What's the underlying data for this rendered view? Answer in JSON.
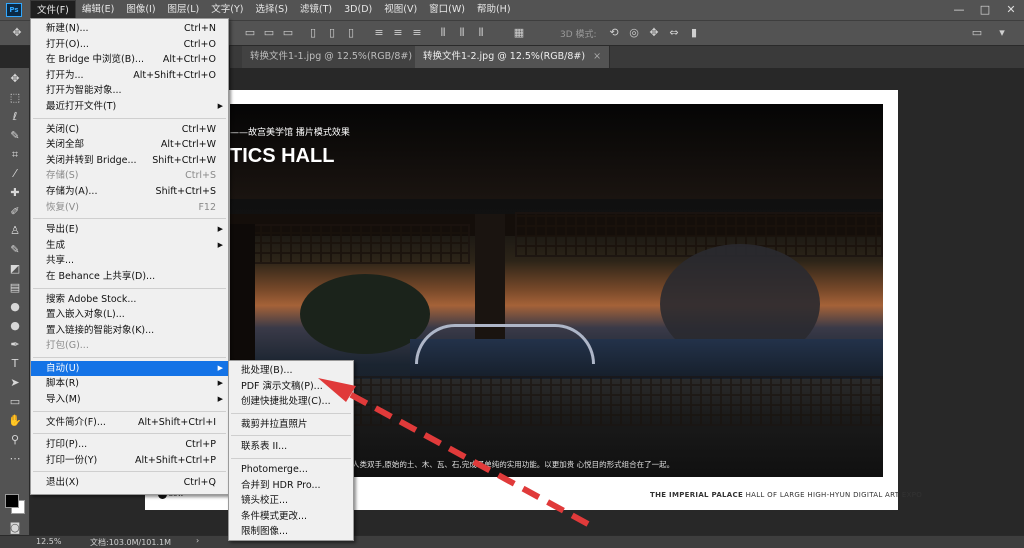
{
  "menubar": {
    "items": [
      "文件(F)",
      "编辑(E)",
      "图像(I)",
      "图层(L)",
      "文字(Y)",
      "选择(S)",
      "滤镜(T)",
      "3D(D)",
      "视图(V)",
      "窗口(W)",
      "帮助(H)"
    ],
    "window_controls": [
      "—",
      "□",
      "✕"
    ]
  },
  "options_bar": {
    "mode_3d": "3D 模式:"
  },
  "tabs": [
    {
      "label": "转换文件1-1.jpg @ 12.5%(RGB/8#)",
      "close": "×"
    },
    {
      "label": "转换文件1-2.jpg @ 12.5%(RGB/8#)",
      "close": "×"
    }
  ],
  "file_menu": {
    "groups": [
      [
        {
          "label": "新建(N)...",
          "shortcut": "Ctrl+N"
        },
        {
          "label": "打开(O)...",
          "shortcut": "Ctrl+O"
        },
        {
          "label": "在 Bridge 中浏览(B)...",
          "shortcut": "Alt+Ctrl+O"
        },
        {
          "label": "打开为...",
          "shortcut": "Alt+Shift+Ctrl+O"
        },
        {
          "label": "打开为智能对象..."
        },
        {
          "label": "最近打开文件(T)",
          "submenu": true
        }
      ],
      [
        {
          "label": "关闭(C)",
          "shortcut": "Ctrl+W"
        },
        {
          "label": "关闭全部",
          "shortcut": "Alt+Ctrl+W"
        },
        {
          "label": "关闭并转到 Bridge...",
          "shortcut": "Shift+Ctrl+W"
        },
        {
          "label": "存储(S)",
          "shortcut": "Ctrl+S",
          "disabled": true
        },
        {
          "label": "存储为(A)...",
          "shortcut": "Shift+Ctrl+S"
        },
        {
          "label": "恢复(V)",
          "shortcut": "F12",
          "disabled": true
        }
      ],
      [
        {
          "label": "导出(E)",
          "submenu": true
        },
        {
          "label": "生成",
          "submenu": true
        },
        {
          "label": "共享..."
        },
        {
          "label": "在 Behance 上共享(D)..."
        }
      ],
      [
        {
          "label": "搜索 Adobe Stock..."
        },
        {
          "label": "置入嵌入对象(L)..."
        },
        {
          "label": "置入链接的智能对象(K)..."
        },
        {
          "label": "打包(G)...",
          "disabled": true
        }
      ],
      [
        {
          "label": "自动(U)",
          "submenu": true,
          "highlighted": true
        },
        {
          "label": "脚本(R)",
          "submenu": true
        },
        {
          "label": "导入(M)",
          "submenu": true
        }
      ],
      [
        {
          "label": "文件简介(F)...",
          "shortcut": "Alt+Shift+Ctrl+I"
        }
      ],
      [
        {
          "label": "打印(P)...",
          "shortcut": "Ctrl+P"
        },
        {
          "label": "打印一份(Y)",
          "shortcut": "Alt+Shift+Ctrl+P"
        }
      ],
      [
        {
          "label": "退出(X)",
          "shortcut": "Ctrl+Q"
        }
      ]
    ]
  },
  "automate_submenu": {
    "groups": [
      [
        "批处理(B)...",
        "PDF 演示文稿(P)...",
        "创建快捷批处理(C)..."
      ],
      [
        "裁剪并拉直照片"
      ],
      [
        "联系表 II..."
      ],
      [
        "Photomerge...",
        "合并到 HDR Pro...",
        "镜头校正...",
        "条件模式更改...",
        "限制图像..."
      ]
    ]
  },
  "document": {
    "subtitle": "——故宫美学馆 播片模式效果",
    "title": "TICS HALL",
    "caption": "人类双手,原始的土、木、瓦、石,完成了单纯的实用功能。以更加贵 心悦目的形式组合在了一起。",
    "footer_bold": "THE IMPERIAL PALACE",
    "footer_rest": "HALL OF LARGE HIGH-HYUN DIGITAL ART EXPO",
    "logo": "BOW"
  },
  "status_bar": {
    "zoom": "12.5%",
    "doc_info": "文档:103.0M/101.1M"
  },
  "colors": {
    "highlight": "#1473e6",
    "annotation_arrow": "#e03a3a"
  }
}
